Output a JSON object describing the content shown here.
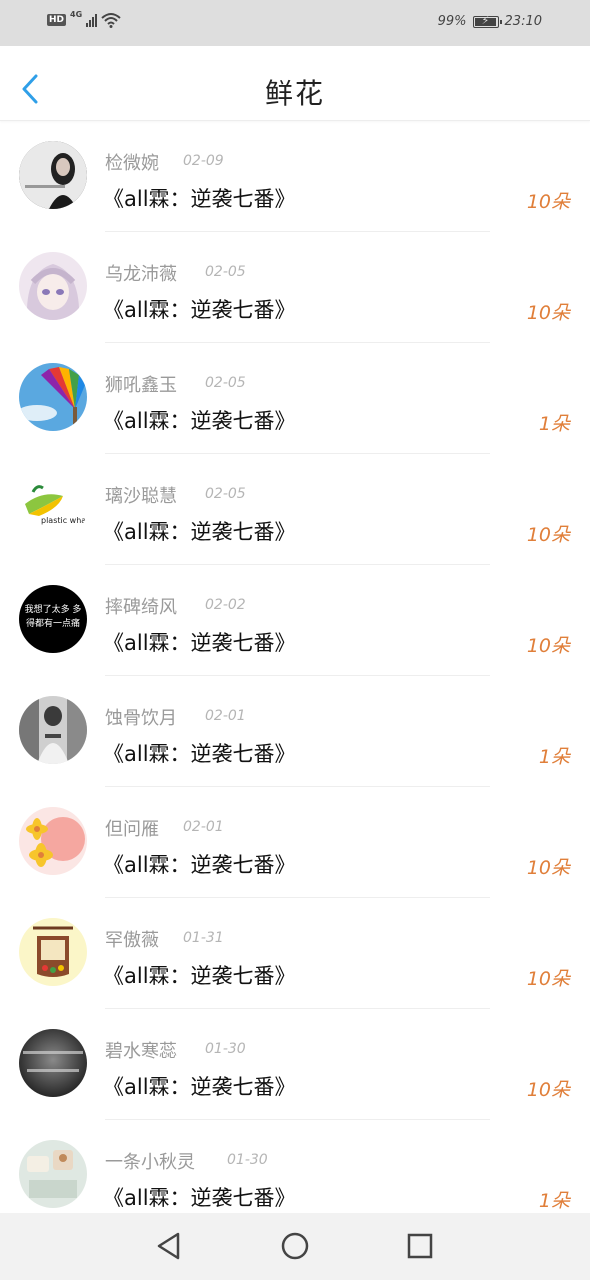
{
  "status_bar": {
    "network_badge": "HD",
    "network_type": "4G",
    "battery_percent": "99%",
    "time": "23:10"
  },
  "header": {
    "title": "鲜花"
  },
  "colors": {
    "accent": "#2f9fe8",
    "count": "#e07f3a"
  },
  "items": [
    {
      "name": "检微婉",
      "date": "02-09",
      "book": "《all霖：逆袭七番》",
      "count": "10朵"
    },
    {
      "name": "乌龙沛薇",
      "date": "02-05",
      "book": "《all霖：逆袭七番》",
      "count": "10朵"
    },
    {
      "name": "狮吼鑫玉",
      "date": "02-05",
      "book": "《all霖：逆袭七番》",
      "count": "1朵"
    },
    {
      "name": "璃沙聪慧",
      "date": "02-05",
      "book": "《all霖：逆袭七番》",
      "count": "10朵",
      "avatar_text": "plastic whale"
    },
    {
      "name": "摔碑绮风",
      "date": "02-02",
      "book": "《all霖：逆袭七番》",
      "count": "10朵",
      "avatar_text": "我想了太多 多得都有一点痛"
    },
    {
      "name": "蚀骨饮月",
      "date": "02-01",
      "book": "《all霖：逆袭七番》",
      "count": "1朵"
    },
    {
      "name": "但问雁",
      "date": "02-01",
      "book": "《all霖：逆袭七番》",
      "count": "10朵"
    },
    {
      "name": "罕傲薇",
      "date": "01-31",
      "book": "《all霖：逆袭七番》",
      "count": "10朵"
    },
    {
      "name": "碧水寒蕊",
      "date": "01-30",
      "book": "《all霖：逆袭七番》",
      "count": "10朵"
    },
    {
      "name": "一条小秋灵",
      "date": "01-30",
      "book": "《all霖：逆袭七番》",
      "count": "1朵"
    }
  ],
  "navigation": {
    "back_icon": "triangle-back-icon",
    "home_icon": "circle-home-icon",
    "recents_icon": "square-recents-icon"
  }
}
